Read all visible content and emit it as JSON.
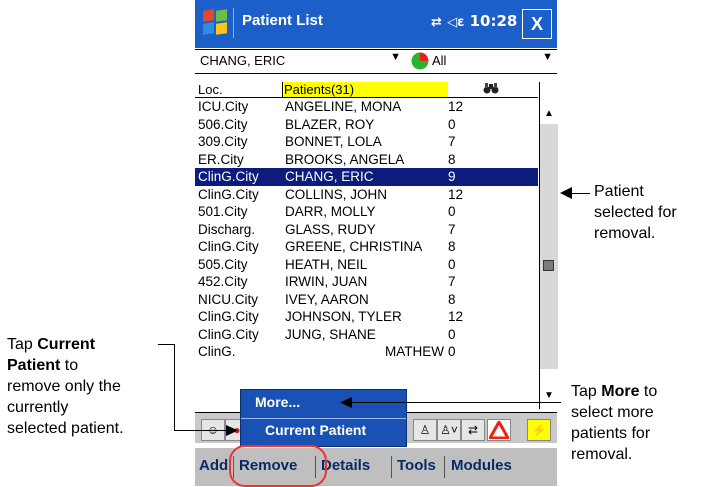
{
  "window": {
    "title": "Patient List",
    "time": "10:28",
    "status_icons": "⇄ ◁",
    "close_label": "X"
  },
  "filters": {
    "patient_select": "CHANG, ERIC",
    "group_select": "All"
  },
  "list": {
    "columns": [
      "Loc.",
      "Patients(31)",
      ""
    ],
    "rows": [
      {
        "loc": "ICU.City",
        "name": "ANGELINE, MONA",
        "num": "12"
      },
      {
        "loc": "506.City",
        "name": "BLAZER, ROY",
        "num": "0"
      },
      {
        "loc": "309.City",
        "name": "BONNET, LOLA",
        "num": "7"
      },
      {
        "loc": "ER.City",
        "name": "BROOKS, ANGELA",
        "num": "8"
      },
      {
        "loc": "ClinG.City",
        "name": "CHANG, ERIC",
        "num": "9"
      },
      {
        "loc": "ClinG.City",
        "name": "COLLINS, JOHN",
        "num": "12"
      },
      {
        "loc": "501.City",
        "name": "DARR, MOLLY",
        "num": "0"
      },
      {
        "loc": "Discharg.",
        "name": "GLASS, RUDY",
        "num": "7"
      },
      {
        "loc": "ClinG.City",
        "name": "GREENE, CHRISTINA",
        "num": "8"
      },
      {
        "loc": "505.City",
        "name": "HEATH, NEIL",
        "num": "0"
      },
      {
        "loc": "452.City",
        "name": "IRWIN, JUAN",
        "num": "7"
      },
      {
        "loc": "NICU.City",
        "name": "IVEY, AARON",
        "num": "8"
      },
      {
        "loc": "ClinG.City",
        "name": "JOHNSON, TYLER",
        "num": "12"
      },
      {
        "loc": "ClinG.City",
        "name": "JUNG, SHANE",
        "num": "0"
      },
      {
        "loc": "ClinG.",
        "name": "MATHEW",
        "num": "0"
      }
    ]
  },
  "popup": {
    "more": "More...",
    "current_patient": "Current Patient"
  },
  "menu": {
    "add": "Add",
    "remove": "Remove",
    "details": "Details",
    "tools": "Tools",
    "modules": "Modules"
  },
  "callouts": {
    "selected": [
      "Patient",
      "selected for",
      "removal."
    ],
    "current_prefix": "Tap ",
    "current_bold1": "Current",
    "current_bold2": "Patient",
    "current_rest": [
      " to",
      "remove only the",
      "currently",
      "selected patient."
    ],
    "more_prefix": "Tap ",
    "more_bold": "More",
    "more_rest": [
      " to",
      "select more",
      "patients for",
      "removal."
    ]
  },
  "colors": {
    "titlebar": "#1d5fc8",
    "selected_row": "#0b1c7c",
    "header_highlight": "#ffff00",
    "popup": "#1a51b4",
    "highlight_oval": "#e33333"
  }
}
